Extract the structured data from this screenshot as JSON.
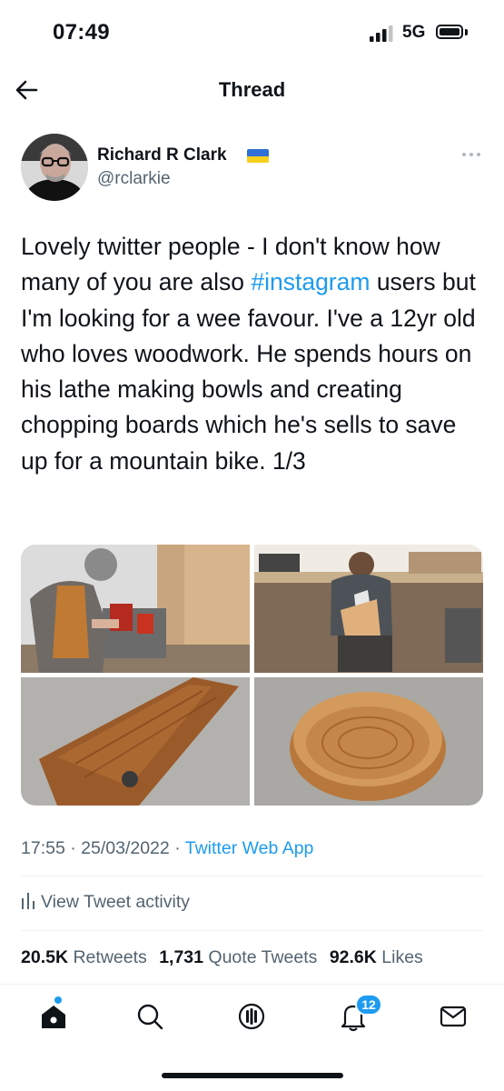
{
  "status_bar": {
    "time": "07:49",
    "network": "5G"
  },
  "header": {
    "title": "Thread"
  },
  "author": {
    "name": "Richard R Clark",
    "handle": "@rclarkie"
  },
  "tweet": {
    "text_before": "Lovely twitter people - I don't know how many of you are also ",
    "hashtag": "#instagram",
    "text_after": " users but I'm looking for a wee favour. I've a 12yr old who loves woodwork. He spends hours on his lathe making bowls and creating chopping boards which he's sells to save up for a mountain bike. 1/3"
  },
  "meta": {
    "time": "17:55",
    "date": "25/03/2022",
    "source": "Twitter Web App",
    "separator": "·"
  },
  "activity": {
    "label": "View Tweet activity"
  },
  "stats": {
    "retweets_count": "20.5K",
    "retweets_label": "Retweets",
    "quotes_count": "1,731",
    "quotes_label": "Quote Tweets",
    "likes_count": "92.6K",
    "likes_label": "Likes"
  },
  "tabbar": {
    "items": [
      "home-icon",
      "search-icon",
      "spaces-icon",
      "notifications-icon",
      "messages-icon"
    ],
    "notifications_badge": "12"
  },
  "colors": {
    "accent": "#1d9bf0",
    "secondary_text": "#536471",
    "primary_text": "#0f1419",
    "flag_blue": "#2f6fd6",
    "flag_yellow": "#f6cf1d"
  }
}
